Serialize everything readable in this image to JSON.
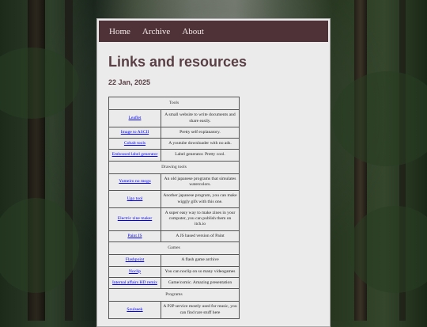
{
  "nav": {
    "items": [
      "Home",
      "Archive",
      "About"
    ]
  },
  "article": {
    "title": "Links and resources",
    "date": "22 Jan, 2025"
  },
  "table": {
    "sections": [
      {
        "heading": "Tools",
        "rows": [
          {
            "name": "Leaflet",
            "description": "A small website to write documents and share easily."
          },
          {
            "name": "Image to ASCII",
            "description": "Pretty self explanatory."
          },
          {
            "name": "Cobalt tools",
            "description": "A youtube downloader with no ads."
          },
          {
            "name": "Embossed label generator",
            "description": "Label generator. Pretty cool."
          }
        ]
      },
      {
        "heading": "Drawing tools",
        "rows": [
          {
            "name": "Yumeiro no mogu",
            "description": "An old japanese programs that simulates watercolors."
          },
          {
            "name": "Ugo tool",
            "description": "Another japanese program, you can make wiggly gifs with this one."
          },
          {
            "name": "Electric zine maker",
            "description": "A super easy way to make zines in your computer, you can publish them on itch.io"
          },
          {
            "name": "Paint JS",
            "description": "A JS based version of Paint"
          }
        ]
      },
      {
        "heading": "Games",
        "rows": [
          {
            "name": "Flashpoint",
            "description": "A flash game archive"
          },
          {
            "name": "Noclip",
            "description": "You can noclip on so many videogames"
          },
          {
            "name": "Internal affairs HD remix",
            "description": "Game/comic. Amazing presentation"
          }
        ]
      },
      {
        "heading": "Programs",
        "rows": [
          {
            "name": "Soulseek",
            "description": "A P2P service mostly used for music, you can find rare stuff here"
          }
        ]
      }
    ]
  }
}
